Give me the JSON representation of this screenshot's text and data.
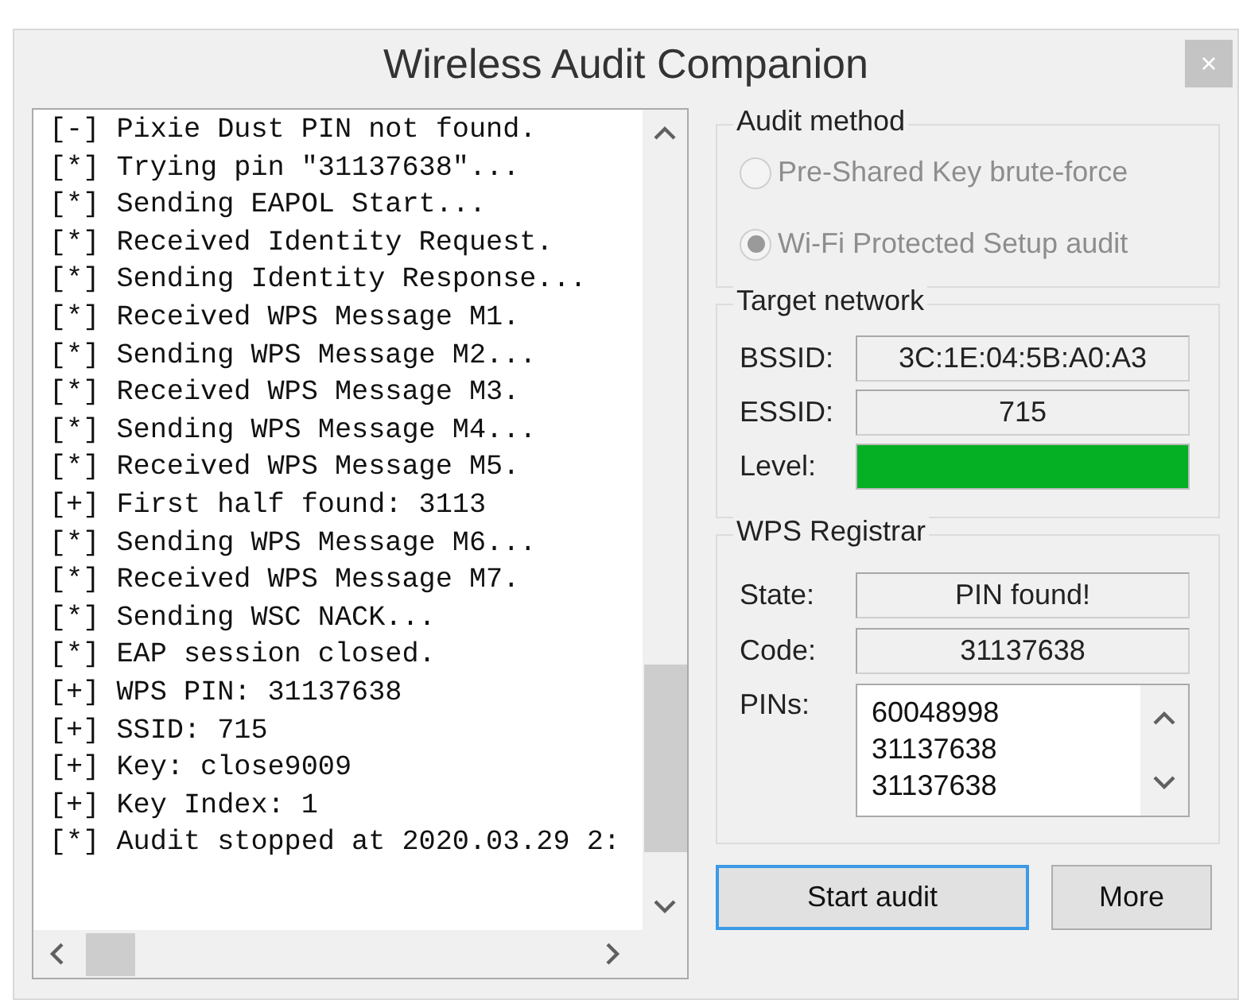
{
  "window": {
    "title": "Wireless Audit Companion",
    "close": "×"
  },
  "log": {
    "lines": [
      "[-] Pixie Dust PIN not found.",
      "[*] Trying pin \"31137638\"...",
      "[*] Sending EAPOL Start...",
      "[*] Received Identity Request.",
      "[*] Sending Identity Response...",
      "[*] Received WPS Message M1.",
      "[*] Sending WPS Message M2...",
      "[*] Received WPS Message M3.",
      "[*] Sending WPS Message M4...",
      "[*] Received WPS Message M5.",
      "[+] First half found: 3113",
      "[*] Sending WPS Message M6...",
      "[*] Received WPS Message M7.",
      "[*] Sending WSC NACK...",
      "[*] EAP session closed.",
      "[+] WPS PIN: 31137638",
      "[+] SSID: 715",
      "[+] Key: close9009",
      "[+] Key Index: 1",
      "[*] Audit stopped at 2020.03.29 2:"
    ]
  },
  "audit_method": {
    "title": "Audit method",
    "options": [
      {
        "label": "Pre-Shared Key brute-force",
        "selected": false,
        "disabled": true
      },
      {
        "label": "Wi-Fi Protected Setup audit",
        "selected": true,
        "disabled": true
      }
    ]
  },
  "target_network": {
    "title": "Target network",
    "bssid_label": "BSSID:",
    "bssid": "3C:1E:04:5B:A0:A3",
    "essid_label": "ESSID:",
    "essid": "715",
    "level_label": "Level:",
    "level": 1
  },
  "wps_registrar": {
    "title": "WPS Registrar",
    "state_label": "State:",
    "state": "PIN found!",
    "code_label": "Code:",
    "code": "31137638",
    "pins_label": "PINs:",
    "pins": [
      "60048998",
      "31137638",
      "31137638"
    ]
  },
  "buttons": [
    {
      "label": "Start audit",
      "focused": true
    },
    {
      "label": "More",
      "focused": false
    }
  ]
}
